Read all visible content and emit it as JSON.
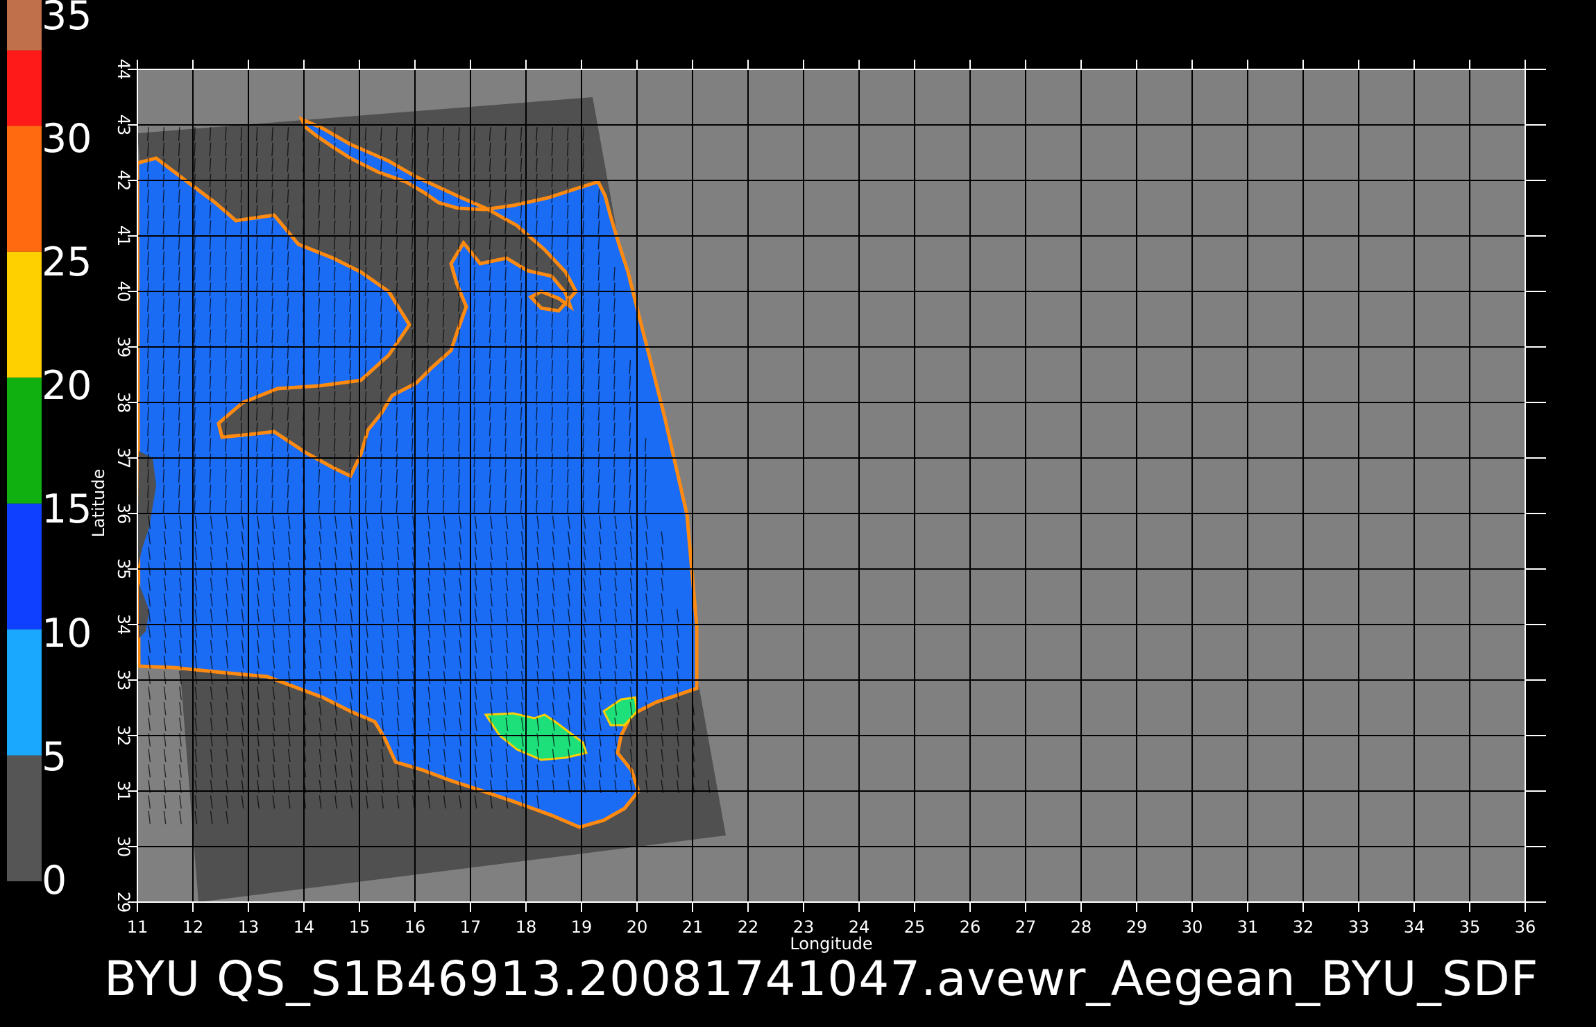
{
  "colorbar": {
    "labels": [
      "35",
      "30",
      "25",
      "20",
      "15",
      "10",
      "5",
      "0"
    ],
    "values": [
      35,
      30,
      25,
      20,
      15,
      10,
      5,
      0
    ],
    "range": [
      0,
      35
    ],
    "bands": [
      {
        "from": 33,
        "to": 35,
        "color": "#c0704a"
      },
      {
        "from": 30,
        "to": 33,
        "color": "#ff1a1a"
      },
      {
        "from": 25,
        "to": 30,
        "color": "#ff6a10"
      },
      {
        "from": 20,
        "to": 25,
        "color": "#ffd000"
      },
      {
        "from": 15,
        "to": 20,
        "color": "#0fb00f"
      },
      {
        "from": 10,
        "to": 15,
        "color": "#1040ff"
      },
      {
        "from": 5,
        "to": 10,
        "color": "#1aa8ff"
      },
      {
        "from": 0,
        "to": 5,
        "color": "#555555"
      }
    ]
  },
  "chart_data": {
    "type": "heatmap",
    "title": "",
    "xlabel": "Longitude",
    "ylabel": "Latitude",
    "xlim": [
      11,
      36
    ],
    "ylim": [
      29,
      44
    ],
    "x_ticks": [
      "11",
      "12",
      "13",
      "14",
      "15",
      "16",
      "17",
      "18",
      "19",
      "20",
      "21",
      "22",
      "23",
      "24",
      "25",
      "26",
      "27",
      "28",
      "29",
      "30",
      "31",
      "32",
      "33",
      "34",
      "35",
      "36"
    ],
    "y_ticks": [
      "29",
      "30",
      "31",
      "32",
      "33",
      "34",
      "35",
      "36",
      "37",
      "38",
      "39",
      "40",
      "41",
      "42",
      "43",
      "44"
    ],
    "grid": true,
    "swath_corners": [
      [
        11.0,
        42.85
      ],
      [
        19.2,
        43.5
      ],
      [
        21.6,
        30.2
      ],
      [
        12.1,
        29.0
      ]
    ],
    "colors": {
      "plot_background": "#808080",
      "swath_land": "#505050",
      "sea": "#1a6cf5",
      "grid": "#000000",
      "wind_vectors": "#000000"
    }
  },
  "footer": {
    "text": "BYU  QS_S1B46913.20081741047.avewr_Aegean_BYU_SDF"
  }
}
